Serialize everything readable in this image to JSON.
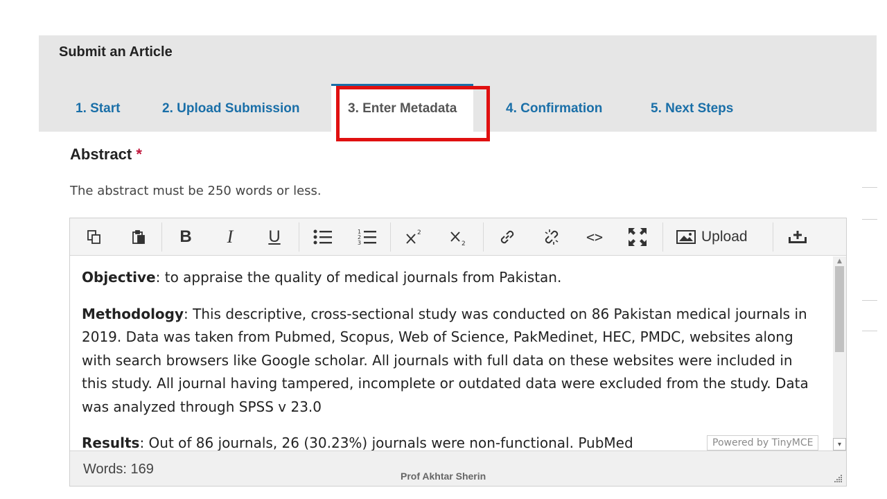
{
  "page": {
    "title": "Submit an Article"
  },
  "tabs": [
    {
      "label": "1. Start",
      "active": false
    },
    {
      "label": "2. Upload Submission",
      "active": false
    },
    {
      "label": "3. Enter Metadata",
      "active": true
    },
    {
      "label": "4. Confirmation",
      "active": false
    },
    {
      "label": "5. Next Steps",
      "active": false
    }
  ],
  "colors": {
    "accent": "#1a6fa8",
    "highlight": "#e01010",
    "required": "#c0163b",
    "band": "#e6e6e6"
  },
  "abstract": {
    "label": "Abstract",
    "required_marker": "*",
    "description": "The abstract must be 250 words or less."
  },
  "editor": {
    "toolbar": {
      "copy": "copy-icon",
      "paste": "paste-icon",
      "bold": "B",
      "italic": "I",
      "underline": "U",
      "bullet_list": "bullet-list-icon",
      "numbered_list": "numbered-list-icon",
      "superscript": "superscript-icon",
      "subscript": "subscript-icon",
      "link": "link-icon",
      "unlink": "unlink-icon",
      "code": "<>",
      "fullscreen": "fullscreen-icon",
      "upload_label": "Upload",
      "insert": "insert-icon"
    },
    "content": {
      "objective_label": "Objective",
      "objective_text": ": to appraise the  quality of medical journals from Pakistan.",
      "methodology_label": "Methodology",
      "methodology_text": ": This descriptive, cross-sectional study was conducted on 86 Pakistan medical journals in 2019. Data was taken from Pubmed, Scopus, Web of Science, PakMedinet, HEC, PMDC, websites along with search browsers like Google scholar. All journals with full data on these websites were included in this study. All journal having tampered, incomplete or outdated data were excluded from the study. Data was analyzed through SPSS v 23.0",
      "results_label": "Results",
      "results_text": ": Out of 86 journals, 26 (30.23%) journals were non-functional. PubMed"
    },
    "powered_by": "Powered by TinyMCE",
    "word_count": "Words: 169"
  },
  "footer": {
    "credit": "Prof Akhtar Sherin"
  }
}
